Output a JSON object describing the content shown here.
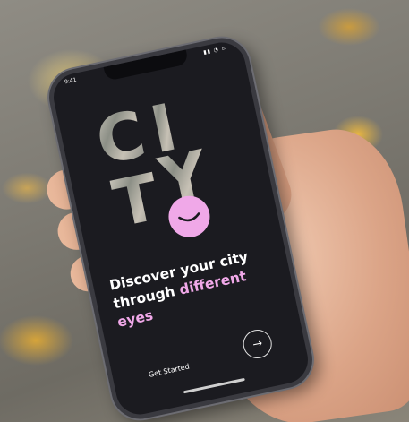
{
  "status_bar": {
    "time": "9:41",
    "icons": "▮▮ ◔ ▭"
  },
  "logo": {
    "letters": [
      "C",
      "I",
      "T",
      "Y"
    ]
  },
  "headline": {
    "line1": "Discover your city",
    "line2_plain": "through ",
    "line2_accent": "different",
    "line3_accent": "eyes"
  },
  "cta": {
    "label": "Get Started",
    "arrow": "→"
  },
  "icons": {
    "smile": "smile-icon",
    "next": "arrow-right-icon"
  },
  "colors": {
    "accent": "#f0a8e8",
    "screen_bg": "#1b1b20",
    "text": "#ffffff"
  }
}
